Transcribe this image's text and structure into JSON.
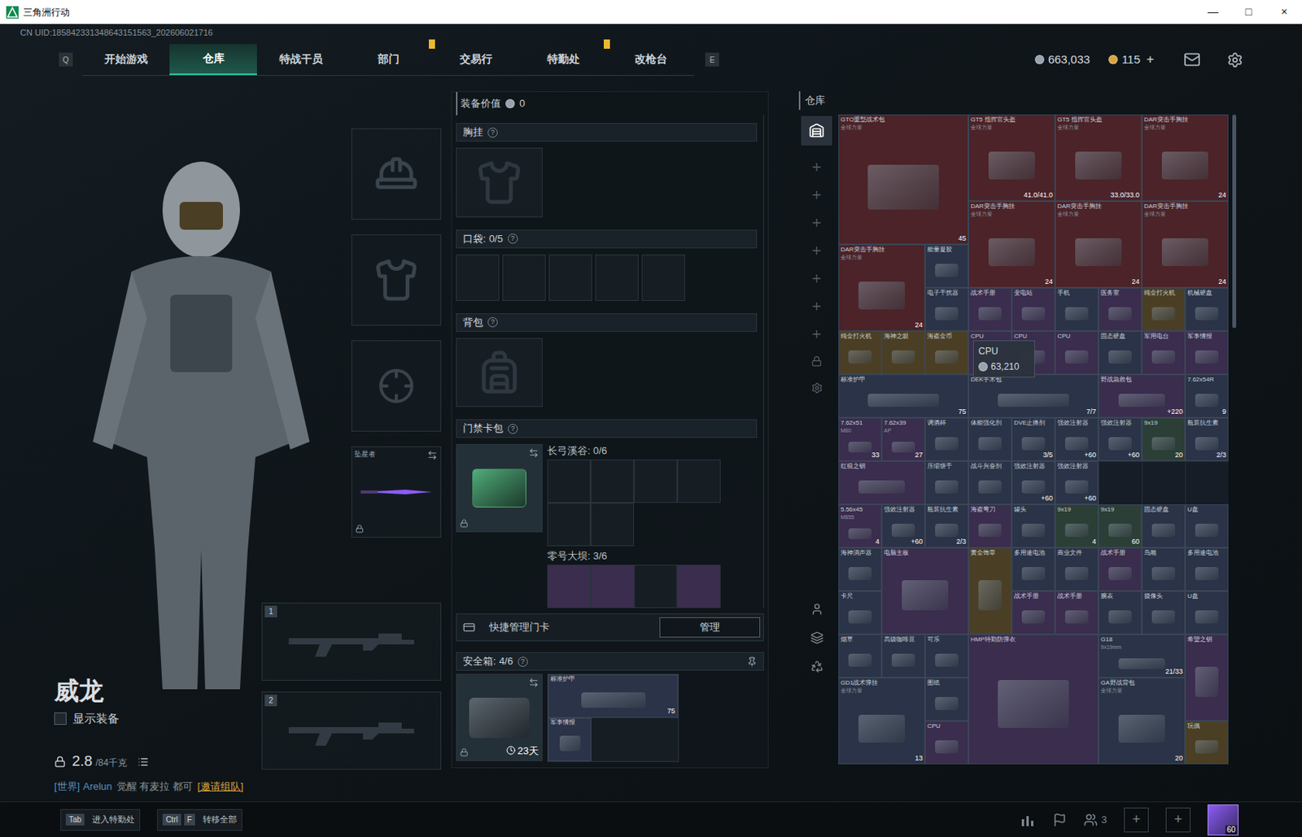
{
  "window": {
    "title": "三角洲行动",
    "controls": [
      "—",
      "□",
      "×"
    ]
  },
  "uid": "CN UID:185842331348643151563_202606021716",
  "nav": {
    "prev_key": "Q",
    "next_key": "E",
    "tabs": [
      {
        "label": "开始游戏",
        "selected": false,
        "alert": false
      },
      {
        "label": "仓库",
        "selected": true,
        "alert": false
      },
      {
        "label": "特战干员",
        "selected": false,
        "alert": false
      },
      {
        "label": "部门",
        "selected": false,
        "alert": true
      },
      {
        "label": "交易行",
        "selected": false,
        "alert": false
      },
      {
        "label": "特勤处",
        "selected": false,
        "alert": true
      },
      {
        "label": "改枪台",
        "selected": false,
        "alert": false
      }
    ],
    "currencies": [
      {
        "value": "663,033",
        "color": "#9aa3ad"
      },
      {
        "value": "115",
        "color": "#d9a441",
        "action": "+"
      }
    ]
  },
  "operator": {
    "name": "威龙",
    "show_equipment": {
      "label": "显示装备",
      "checked": false
    },
    "weight": "2.8",
    "capacity": "/84千克"
  },
  "chat": {
    "channel": "[世界]",
    "user": "Arelun",
    "message": "觉醒 有麦拉 都可",
    "link": "[邀请组队]"
  },
  "gear_slots": [
    {
      "kind": "helmet",
      "locked": false
    },
    {
      "kind": "armor",
      "locked": false
    },
    {
      "kind": "pistol",
      "locked": false
    },
    {
      "kind": "melee",
      "label": "坠星者",
      "locked": true
    }
  ],
  "weapon_slots": [
    {
      "number": "1"
    },
    {
      "number": "2"
    }
  ],
  "loadout": {
    "value_label": "装备价值",
    "value": "0",
    "chest_rig": {
      "title": "胸挂",
      "help": "?"
    },
    "pockets": {
      "title": "口袋:",
      "count": "0/5",
      "help": "?",
      "slots": [
        {
          "filled": false
        },
        {
          "filled": false
        },
        {
          "filled": false
        },
        {
          "filled": false
        },
        {
          "filled": false
        }
      ]
    },
    "backpack": {
      "title": "背包",
      "help": "?"
    },
    "keycard_case": {
      "title": "门禁卡包",
      "help": "?",
      "locked": true,
      "maps": [
        {
          "label": "长弓溪谷:",
          "count": "0/6",
          "cards": [
            false,
            false,
            false,
            false,
            false,
            false
          ]
        },
        {
          "label": "零号大坝:",
          "count": "3/6",
          "cards": [
            true,
            true,
            false,
            true
          ]
        }
      ]
    },
    "quick_manage": {
      "label": "快捷管理门卡",
      "button": "管理"
    },
    "safe": {
      "title": "安全箱:",
      "count": "4/6",
      "help": "?",
      "days": "23天",
      "locked": true,
      "items": [
        {
          "name": "标准护甲",
          "count": "75"
        },
        {
          "name": "军事情报"
        }
      ]
    }
  },
  "warehouse": {
    "title": "仓库",
    "tooltip": {
      "name": "CPU",
      "price": "63,210"
    },
    "items": [
      {
        "name": "GTO重型战术包",
        "tag": "全球力量",
        "count": "45",
        "color": "#4b2328"
      },
      {
        "name": "GT5 指挥官头盔",
        "tag": "全球力量",
        "count": "41.0/41.0",
        "color": "#4b2328"
      },
      {
        "name": "GT5 指挥官头盔",
        "tag": "全球力量",
        "count": "33.0/33.0",
        "color": "#4b2328"
      },
      {
        "name": "DAR突击手胸挂",
        "tag": "全球力量",
        "count": "24",
        "color": "#4b2328"
      },
      {
        "name": "DAR突击手胸挂",
        "tag": "全球力量",
        "count": "24",
        "color": "#4b2328"
      },
      {
        "name": "DAR突击手胸挂",
        "tag": "全球力量",
        "count": "24",
        "color": "#4b2328"
      },
      {
        "name": "DAR突击手胸挂",
        "tag": "全球力量",
        "count": "24",
        "color": "#4b2328"
      },
      {
        "name": "DAR突击手胸挂",
        "tag": "全球力量",
        "count": "24",
        "color": "#4b2328"
      },
      {
        "name": "能量凝胶",
        "color": "#2a3347"
      },
      {
        "name": "电子干扰器",
        "color": "#2a3347"
      },
      {
        "name": "战术手册",
        "color": "#3a2d4e"
      },
      {
        "name": "变电站",
        "color": "#3a2d4e"
      },
      {
        "name": "手机",
        "color": "#2a3347"
      },
      {
        "name": "医务室",
        "color": "#3a2d4e"
      },
      {
        "name": "纯金打火机",
        "color": "#4a3f24"
      },
      {
        "name": "机械硬盘",
        "color": "#2a3347"
      },
      {
        "name": "纯金打火机",
        "color": "#4a3f24"
      },
      {
        "name": "海神之眼",
        "color": "#4a3f24"
      },
      {
        "name": "海盗金币",
        "color": "#4a3f24"
      },
      {
        "name": "CPU",
        "color": "#3a2d4e"
      },
      {
        "name": "CPU",
        "color": "#3a2d4e"
      },
      {
        "name": "CPU",
        "color": "#3a2d4e"
      },
      {
        "name": "固态硬盘",
        "color": "#2a3347"
      },
      {
        "name": "军用电台",
        "color": "#3a2d4e"
      },
      {
        "name": "军事情报",
        "color": "#3a2d4e"
      },
      {
        "name": "标准护甲",
        "count": "75",
        "color": "#2a3347"
      },
      {
        "name": "DEK手术包",
        "count": "7/7",
        "color": "#2a3347"
      },
      {
        "name": "野战急救包",
        "count": "+220",
        "color": "#3a2d4e"
      },
      {
        "name": "7.62x54R",
        "count": "9",
        "color": "#2a3347"
      },
      {
        "name": "7.62x51",
        "tag": "M80",
        "count": "33",
        "color": "#3a2d4e"
      },
      {
        "name": "7.62x39",
        "tag": "AP",
        "count": "27",
        "color": "#3a2d4e"
      },
      {
        "name": "调酒杯",
        "color": "#2a3347"
      },
      {
        "name": "体能强化剂",
        "color": "#2a3347"
      },
      {
        "name": "DVE止痛剂",
        "count": "3/5",
        "color": "#2a3347"
      },
      {
        "name": "强效注射器",
        "count": "+60",
        "color": "#2a3347"
      },
      {
        "name": "强效注射器",
        "count": "+60",
        "color": "#2a3347"
      },
      {
        "name": "9x19",
        "count": "20",
        "color": "#2b3f36"
      },
      {
        "name": "瓶装抗生素",
        "count": "2/3",
        "color": "#2a3347"
      },
      {
        "name": "红狼之钥",
        "color": "#3a2d4e"
      },
      {
        "name": "压缩饼干",
        "color": "#2a3347"
      },
      {
        "name": "战斗兴奋剂",
        "color": "#2a3347"
      },
      {
        "name": "强效注射器",
        "count": "+60",
        "color": "#2a3347"
      },
      {
        "name": "强效注射器",
        "count": "+60",
        "color": "#2a3347"
      },
      {
        "name": "5.56x45",
        "tag": "M855",
        "count": "4",
        "color": "#3a2d4e"
      },
      {
        "name": "强效注射器",
        "count": "+60",
        "color": "#2a3347"
      },
      {
        "name": "瓶装抗生素",
        "count": "2/3",
        "color": "#2a3347"
      },
      {
        "name": "海盗弯刀",
        "color": "#3a2d4e"
      },
      {
        "name": "罐头",
        "color": "#2a3347"
      },
      {
        "name": "9x19",
        "count": "4",
        "color": "#2b3f36"
      },
      {
        "name": "9x19",
        "count": "60",
        "color": "#2b3f36"
      },
      {
        "name": "固态硬盘",
        "color": "#2a3347"
      },
      {
        "name": "U盘",
        "color": "#2a3347"
      },
      {
        "name": "海神消声器",
        "color": "#2a3347"
      },
      {
        "name": "电脑主板",
        "color": "#3a2d4e"
      },
      {
        "name": "黄金饰章",
        "color": "#4a3f24"
      },
      {
        "name": "多用途电池",
        "color": "#2a3347"
      },
      {
        "name": "商业文件",
        "color": "#2a3347"
      },
      {
        "name": "战术手册",
        "color": "#3a2d4e"
      },
      {
        "name": "鸟雕",
        "color": "#2a3347"
      },
      {
        "name": "多用途电池",
        "color": "#2a3347"
      },
      {
        "name": "卡尺",
        "color": "#2a3347"
      },
      {
        "name": "战术手册",
        "color": "#3a2d4e"
      },
      {
        "name": "战术手册",
        "color": "#3a2d4e"
      },
      {
        "name": "腕表",
        "color": "#2a3347"
      },
      {
        "name": "摄像头",
        "color": "#2a3347"
      },
      {
        "name": "U盘",
        "color": "#2a3347"
      },
      {
        "name": "烟草",
        "color": "#2a3347"
      },
      {
        "name": "高级咖啡豆",
        "color": "#2a3347"
      },
      {
        "name": "可乐",
        "color": "#2a3347"
      },
      {
        "name": "HMP特勤防弹衣",
        "color": "#3a2d4e"
      },
      {
        "name": "G18",
        "tag": "9x19mm",
        "count": "21/33",
        "color": "#2a3347"
      },
      {
        "name": "希望之钥",
        "color": "#3a2d4e"
      },
      {
        "name": "GD1战术弹挂",
        "tag": "全球力量",
        "count": "13",
        "color": "#2a3347"
      },
      {
        "name": "图纸",
        "color": "#2a3347"
      },
      {
        "name": "GA野战背包",
        "tag": "全球力量",
        "count": "20",
        "color": "#2a3347"
      },
      {
        "name": "CPU",
        "color": "#3a2d4e"
      },
      {
        "name": "玩偶",
        "color": "#4a3f24"
      }
    ]
  },
  "bottom_bar": {
    "hotkeys": [
      {
        "keys": [
          "Tab"
        ],
        "label": "进入特勤处"
      },
      {
        "keys": [
          "Ctrl",
          "F"
        ],
        "label": "转移全部"
      }
    ],
    "friends": "3",
    "invite_slots": [
      "+",
      "+"
    ],
    "level": "60"
  }
}
